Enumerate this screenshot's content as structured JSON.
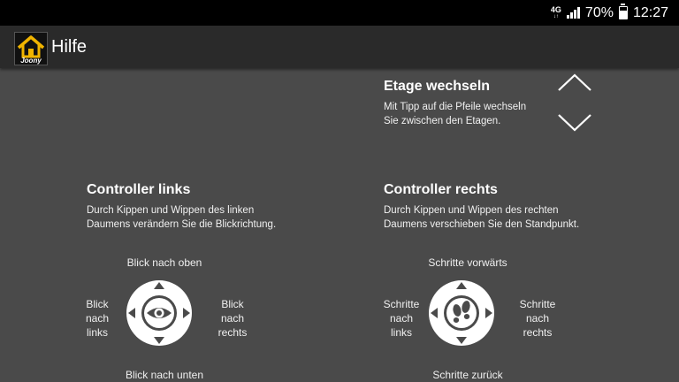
{
  "status_bar": {
    "network": "4G",
    "network_sub": "↓↑",
    "battery": "70%",
    "battery_level": 0.7,
    "time": "12:27"
  },
  "app_bar": {
    "logo_text": "Joony",
    "title": "Hilfe"
  },
  "floor": {
    "title": "Etage wechseln",
    "description": "Mit Tipp auf die Pfeile wechseln\nSie zwischen den Etagen."
  },
  "controller_left": {
    "title": "Controller links",
    "description": "Durch Kippen und Wippen des linken\nDaumens verändern Sie die Blickrichtung.",
    "label_top": "Blick nach oben",
    "label_bottom": "Blick nach unten",
    "label_left": "Blick\nnach\nlinks",
    "label_right": "Blick\nnach\nrechts",
    "center_icon": "eye-icon"
  },
  "controller_right": {
    "title": "Controller rechts",
    "description": "Durch Kippen und Wippen des rechten\nDaumens verschieben Sie den Standpunkt.",
    "label_top": "Schritte vorwärts",
    "label_bottom": "Schritte zurück",
    "label_left": "Schritte\nnach\nlinks",
    "label_right": "Schritte\nnach\nrechts",
    "center_icon": "footsteps-icon"
  },
  "colors": {
    "background": "#4a4a4a",
    "app_bar": "#2a2a2a",
    "status_bar": "#000000",
    "logo_accent": "#f0b400"
  }
}
